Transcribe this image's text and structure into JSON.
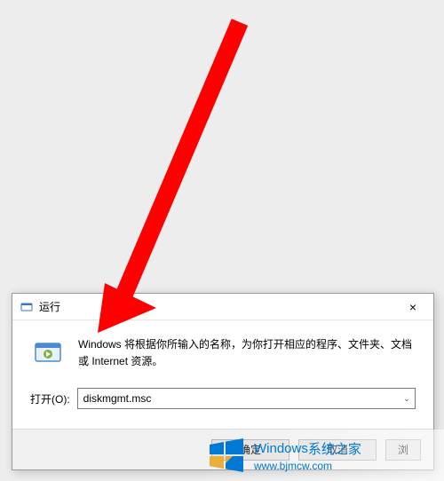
{
  "dialog": {
    "title": "运行",
    "close_label": "×",
    "description": "Windows 将根据你所输入的名称，为你打开相应的程序、文件夹、文档或 Internet 资源。",
    "open_label": "打开(O):",
    "input_value": "diskmgmt.msc",
    "buttons": {
      "ok": "确定",
      "cancel": "取消",
      "browse": "浏"
    }
  },
  "watermark": {
    "brand_prefix": "Windows",
    "brand_suffix": " 系统之家",
    "url": "www.bjmcw.com"
  },
  "colors": {
    "accent": "#0078d4",
    "arrow": "#ff0000"
  }
}
